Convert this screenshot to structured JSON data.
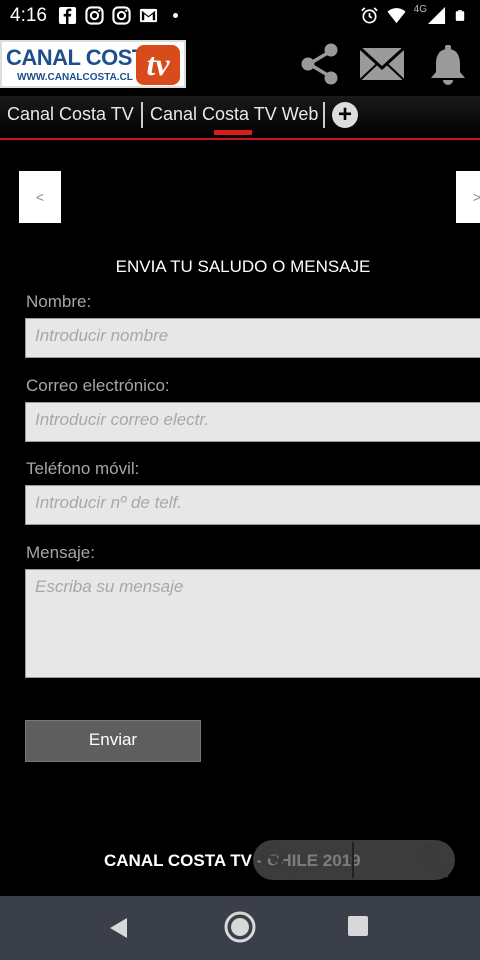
{
  "status_bar": {
    "time": "4:16",
    "network_label": "4G",
    "left_icons": [
      "facebook-icon",
      "instagram-icon",
      "instagram-icon",
      "gmail-icon",
      "dot-icon"
    ],
    "right_icons": [
      "alarm-icon",
      "wifi-icon",
      "signal-icon",
      "battery-icon"
    ]
  },
  "header": {
    "logo_main": "CANAL COSTA",
    "logo_tv": "tv",
    "logo_url": "WWW.CANALCOSTA.CL",
    "icons": [
      "share-icon",
      "mail-icon",
      "bell-icon"
    ]
  },
  "tabs": {
    "items": [
      {
        "label": "Canal Costa TV"
      },
      {
        "label": "Canal Costa TV Web"
      }
    ],
    "add_label": "+"
  },
  "nav_buttons": {
    "prev": "<",
    "next": ">"
  },
  "form": {
    "title": "ENVIA TU SALUDO O MENSAJE",
    "fields": [
      {
        "label": "Nombre:",
        "placeholder": "Introducir nombre"
      },
      {
        "label": "Correo electrónico:",
        "placeholder": "Introducir correo electr."
      },
      {
        "label": "Teléfono móvil:",
        "placeholder": "Introducir nº de telf."
      },
      {
        "label": "Mensaje:",
        "placeholder": "Escriba su mensaje"
      }
    ],
    "submit_label": "Enviar"
  },
  "footer": {
    "text": "CANAL COSTA TV  -  CHILE 2019"
  },
  "colors": {
    "accent_red": "#c8141e",
    "logo_blue": "#1c4f8c",
    "logo_orange": "#d94b1a"
  }
}
